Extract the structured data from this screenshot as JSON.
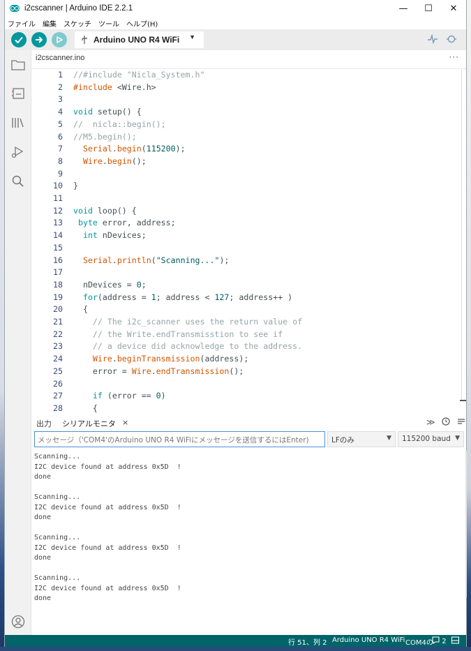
{
  "window": {
    "title": "i2cscanner | Arduino IDE 2.2.1",
    "controls": [
      "—",
      "☐",
      "✕"
    ]
  },
  "menu": [
    "ファイル",
    "編集",
    "スケッチ",
    "ツール",
    "ヘルプ(H)"
  ],
  "toolbar": {
    "verify_icon": "check-icon",
    "upload_icon": "arrow-right-icon",
    "debug_icon": "debug-icon",
    "board_name": "Arduino UNO R4 WiFi",
    "serial_plotter_icon": "pulse-icon",
    "serial_monitor_icon": "magnifier-icon"
  },
  "sidebar": [
    "sketchbook-icon",
    "boards-manager-icon",
    "library-manager-icon",
    "debug-icon",
    "search-icon",
    "account-icon"
  ],
  "tabs": [
    {
      "label": "i2cscanner.ino"
    }
  ],
  "editor": {
    "lines": [
      {
        "n": "1",
        "t": "//#include \"Nicla_System.h\""
      },
      {
        "n": "2",
        "t": "#include <Wire.h>"
      },
      {
        "n": "3",
        "t": ""
      },
      {
        "n": "4",
        "t": "void setup() {"
      },
      {
        "n": "5",
        "t": "//  nicla::begin();"
      },
      {
        "n": "6",
        "t": "//M5.begin();"
      },
      {
        "n": "7",
        "t": "  Serial.begin(115200);"
      },
      {
        "n": "8",
        "t": "  Wire.begin();"
      },
      {
        "n": "9",
        "t": ""
      },
      {
        "n": "10",
        "t": "}"
      },
      {
        "n": "11",
        "t": ""
      },
      {
        "n": "12",
        "t": "void loop() {"
      },
      {
        "n": "13",
        "t": " byte error, address;"
      },
      {
        "n": "14",
        "t": "  int nDevices;"
      },
      {
        "n": "15",
        "t": ""
      },
      {
        "n": "16",
        "t": "  Serial.println(\"Scanning...\");"
      },
      {
        "n": "17",
        "t": ""
      },
      {
        "n": "18",
        "t": "  nDevices = 0;"
      },
      {
        "n": "19",
        "t": "  for(address = 1; address < 127; address++ )"
      },
      {
        "n": "20",
        "t": "  {"
      },
      {
        "n": "21",
        "t": "    // The i2c_scanner uses the return value of"
      },
      {
        "n": "22",
        "t": "    // the Write.endTransmisstion to see if"
      },
      {
        "n": "23",
        "t": "    // a device did acknowledge to the address."
      },
      {
        "n": "24",
        "t": "    Wire.beginTransmission(address);"
      },
      {
        "n": "25",
        "t": "    error = Wire.endTransmission();"
      },
      {
        "n": "26",
        "t": ""
      },
      {
        "n": "27",
        "t": "    if (error == 0)"
      },
      {
        "n": "28",
        "t": "    {"
      }
    ]
  },
  "panel": {
    "tab_output": "出力",
    "tab_serial": "シリアルモニタ",
    "tab_close": "×",
    "input_placeholder": "メッセージ（'COM4'のArduino UNO R4 WiFiにメッセージを送信するにはEnter)",
    "line_ending": "LFのみ",
    "baud": "115200 baud",
    "output": [
      "Scanning...",
      "I2C device found at address 0x5D  !",
      "done",
      "",
      "Scanning...",
      "I2C device found at address 0x5D  !",
      "done",
      "",
      "Scanning...",
      "I2C device found at address 0x5D  !",
      "done",
      "",
      "Scanning...",
      "I2C device found at address 0x5D  !",
      "done"
    ]
  },
  "status": {
    "position": "行 51、列 2",
    "board": "Arduino UNO R4 WiFi",
    "port": "COM4の",
    "notifications": "2"
  },
  "colors": {
    "accent": "#00979d",
    "status_bar": "#006468",
    "toolbar": "#ececec"
  }
}
